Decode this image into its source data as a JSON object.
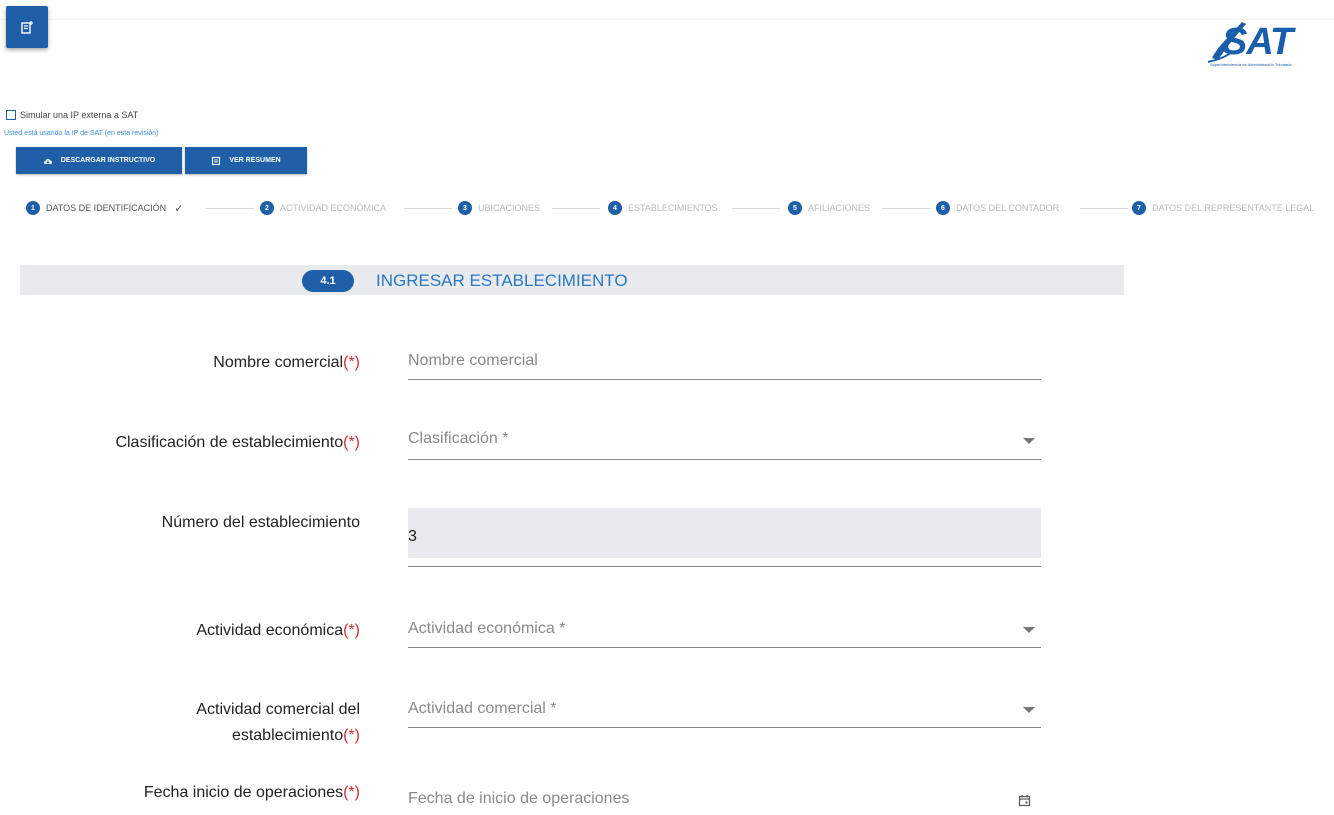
{
  "header": {
    "menu_icon": "menu-document-icon",
    "logo_text": "SAT",
    "logo_tagline": "Superintendencia de Administración Tributaria"
  },
  "options": {
    "simulate_ip_label": "Simular una IP externa a SAT",
    "simulate_ip_checked": false,
    "ip_note": "Usted está usando la IP de SAT (en esta revisión)"
  },
  "buttons": {
    "descargar_label": "DESCARGAR INSTRUCTIVO",
    "descargar_icon": "cloud-download-icon",
    "resumen_label": "VER RESUMEN",
    "resumen_icon": "summary-icon"
  },
  "steps": [
    {
      "num": "1",
      "label": "DATOS DE IDENTIFICACIÓN",
      "done": true
    },
    {
      "num": "2",
      "label": "ACTIVIDAD ECONÓMICA"
    },
    {
      "num": "3",
      "label": "UBICACIONES"
    },
    {
      "num": "4",
      "label": "ESTABLECIMIENTOS"
    },
    {
      "num": "5",
      "label": "AFILIACIONES"
    },
    {
      "num": "6",
      "label": "DATOS DEL CONTADOR"
    },
    {
      "num": "7",
      "label": "DATOS DEL REPRESENTANTE LEGAL"
    }
  ],
  "section": {
    "badge": "4.1",
    "title": "INGRESAR ESTABLECIMIENTO"
  },
  "form": {
    "required_mark": "(*)",
    "nombre_comercial": {
      "label": "Nombre comercial",
      "placeholder": "Nombre comercial"
    },
    "clasificacion": {
      "label": "Clasificación de establecimiento",
      "placeholder": "Clasificación *"
    },
    "numero": {
      "label": "Número del establecimiento",
      "value": "3"
    },
    "actividad_economica": {
      "label": "Actividad económica",
      "placeholder": "Actividad económica *"
    },
    "actividad_comercial": {
      "label_line1": "Actividad comercial del",
      "label_line2": "establecimiento",
      "placeholder": "Actividad comercial *"
    },
    "fecha_inicio": {
      "label": "Fecha inicio de operaciones",
      "placeholder": "Fecha de inicio de operaciones",
      "icon": "calendar-icon"
    }
  },
  "colors": {
    "primary": "#1f5fa8",
    "accent_text": "#2a78c4",
    "required": "#d32f2f",
    "section_bg": "#e8eaed"
  }
}
